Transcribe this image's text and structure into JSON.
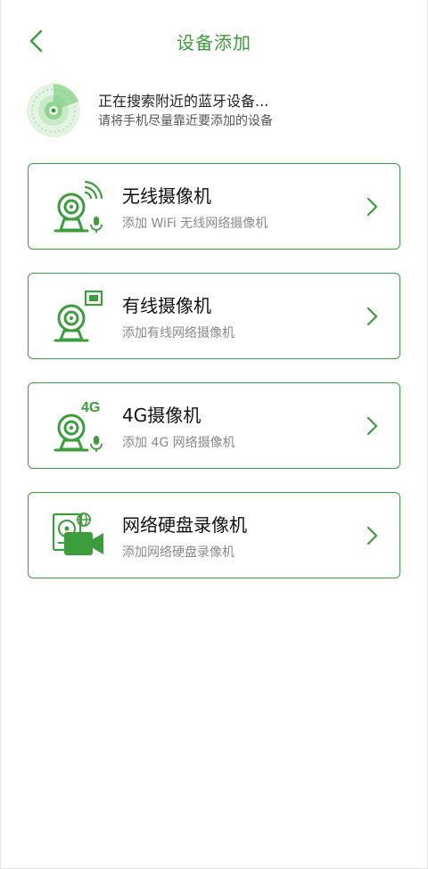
{
  "header": {
    "title": "设备添加",
    "back_icon": "chevron-left-icon"
  },
  "scan": {
    "status": "正在搜索附近的蓝牙设备...",
    "hint": "请将手机尽量靠近要添加的设备",
    "icon": "radar-icon"
  },
  "devices": [
    {
      "title": "无线摄像机",
      "subtitle": "添加 WiFi 无线网络摄像机",
      "icon": "wifi-camera-icon"
    },
    {
      "title": "有线摄像机",
      "subtitle": "添加有线网络摄像机",
      "icon": "wired-camera-icon"
    },
    {
      "title": "4G摄像机",
      "subtitle": "添加 4G 网络摄像机",
      "icon": "4g-camera-icon",
      "badge": "4G"
    },
    {
      "title": "网络硬盘录像机",
      "subtitle": "添加网络硬盘录像机",
      "icon": "nvr-icon"
    }
  ],
  "colors": {
    "accent": "#3c9d3c",
    "text_primary": "#111111",
    "text_secondary": "#8a8a8a"
  }
}
